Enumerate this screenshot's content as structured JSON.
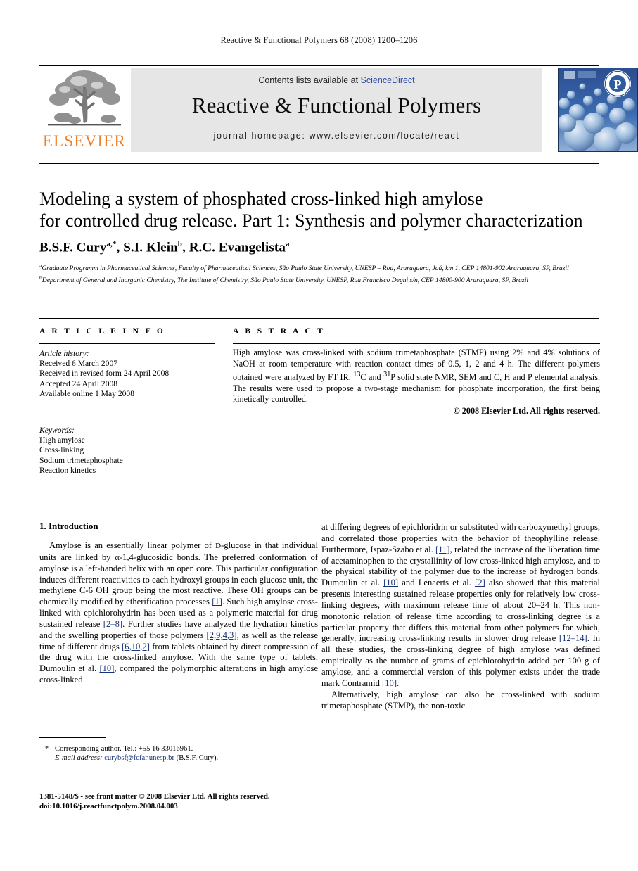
{
  "running_head": "Reactive & Functional Polymers 68 (2008) 1200–1206",
  "masthead": {
    "publisher_name": "ELSEVIER",
    "contents_prefix": "Contents lists available at ",
    "contents_link": "ScienceDirect",
    "journal_title": "Reactive & Functional Polymers",
    "homepage": "journal homepage: www.elsevier.com/locate/react",
    "link_color": "#2b4ba8",
    "publisher_color": "#f07e26",
    "banner_bg": "#e6e6e6"
  },
  "article": {
    "title_line1": "Modeling a system of phosphated cross-linked high amylose",
    "title_line2": "for controlled drug release. Part 1: Synthesis and polymer characterization",
    "authors": [
      {
        "name": "B.S.F. Cury",
        "marks": "a,*"
      },
      {
        "name": "S.I. Klein",
        "marks": "b"
      },
      {
        "name": "R.C. Evangelista",
        "marks": "a"
      }
    ],
    "affiliations": [
      {
        "mark": "a",
        "text": "Graduate Programm in Pharmaceutical Sciences, Faculty of Pharmaceutical Sciences, São Paulo State University, UNESP – Rod, Araraquara, Jaú, km 1, CEP 14801-902 Araraquara, SP, Brazil"
      },
      {
        "mark": "b",
        "text": "Department of General and Inorganic Chemistry, The Institute of Chemistry, São Paulo State University, UNESP, Rua Francisco Degni s/n, CEP 14800-900 Araraquara, SP, Brazil"
      }
    ]
  },
  "article_info": {
    "heading": "A R T I C L E    I N F O",
    "history_label": "Article history:",
    "history": [
      "Received 6 March 2007",
      "Received in revised form 24 April 2008",
      "Accepted 24 April 2008",
      "Available online 1 May 2008"
    ],
    "keywords_label": "Keywords:",
    "keywords": [
      "High amylose",
      "Cross-linking",
      "Sodium trimetaphosphate",
      "Reaction kinetics"
    ]
  },
  "abstract": {
    "heading": "A B S T R A C T",
    "text": "High amylose was cross-linked with sodium trimetaphosphate (STMP) using 2% and 4% solutions of NaOH at room temperature with reaction contact times of 0.5, 1, 2 and 4 h. The different polymers obtained were analyzed by FT IR, 13C and 31P solid state NMR, SEM and C, H and P elemental analysis. The results were used to propose a two-stage mechanism for phosphate incorporation, the first being kinetically controlled.",
    "copyright": "© 2008 Elsevier Ltd. All rights reserved."
  },
  "body": {
    "section_heading": "1. Introduction",
    "left_column": {
      "p1_a": "Amylose is an essentially linear polymer of ",
      "p1_b": "D",
      "p1_c": "-glucose in that individual units are linked by α-1,4-glucosidic bonds. The preferred conformation of amylose is a left-handed helix with an open core. This particular configuration induces different reactivities to each hydroxyl groups in each glucose unit, the methylene C-6 OH group being the most reactive. These OH groups can be chemically modified by etherification processes ",
      "r1": "[1]",
      "p1_d": ". Such high amylose cross-linked with epichlorohydrin has been used as a polymeric material for drug sustained release ",
      "r2": "[2–8]",
      "p1_e": ". Further studies have analyzed the hydration kinetics and the swelling properties of those polymers ",
      "r3": "[2,9,4,3]",
      "p1_f": ", as well as the release time of different drugs ",
      "r4": "[6,10,2]",
      "p1_g": " from tablets obtained by direct compression of the drug with the cross-linked amylose. With the same type of tablets, Dumoulin et al. ",
      "r5": "[10]",
      "p1_h": ", compared the polymorphic alterations in high amylose cross-linked"
    },
    "right_column": {
      "p1_a": "at differing degrees of epichloridrin or substituted with carboxymethyl groups, and correlated those properties with the behavior of theophylline release. Furthermore, Ispaz-Szabo et al. ",
      "r1": "[11]",
      "p1_b": ", related the increase of the liberation time of acetaminophen to the crystallinity of low cross-linked high amylose, and to the physical stability of the polymer due to the increase of hydrogen bonds. Dumoulin et al. ",
      "r2": "[10]",
      "p1_c": " and Lenaerts et al. ",
      "r3": "[2]",
      "p1_d": " also showed that this material presents interesting sustained release properties only for relatively low cross-linking degrees, with maximum release time of about 20–24 h. This non-monotonic relation of release time according to cross-linking degree is a particular property that differs this material from other polymers for which, generally, increasing cross-linking results in slower drug release ",
      "r4": "[12–14]",
      "p1_e": ". In all these studies, the cross-linking degree of high amylose was defined empirically as the number of grams of epichlorohydrin added per 100 g of amylose, and a commercial version of this polymer exists under the trade mark Contramid ",
      "r5": "[10]",
      "p1_f": ".",
      "p2_a": "Alternatively, high amylose can also be cross-linked with sodium trimetaphosphate (STMP), the non-toxic"
    }
  },
  "footnote": {
    "marker": "*",
    "line1": "Corresponding author. Tel.: +55 16 33016961.",
    "email_label": "E-mail address:",
    "email": "curybsf@fcfar.unesp.br",
    "email_owner": "(B.S.F. Cury).",
    "link_color": "#19337a"
  },
  "footer": {
    "line1": "1381-5148/$ - see front matter © 2008 Elsevier Ltd. All rights reserved.",
    "line2": "doi:10.1016/j.reactfunctpolym.2008.04.003"
  }
}
